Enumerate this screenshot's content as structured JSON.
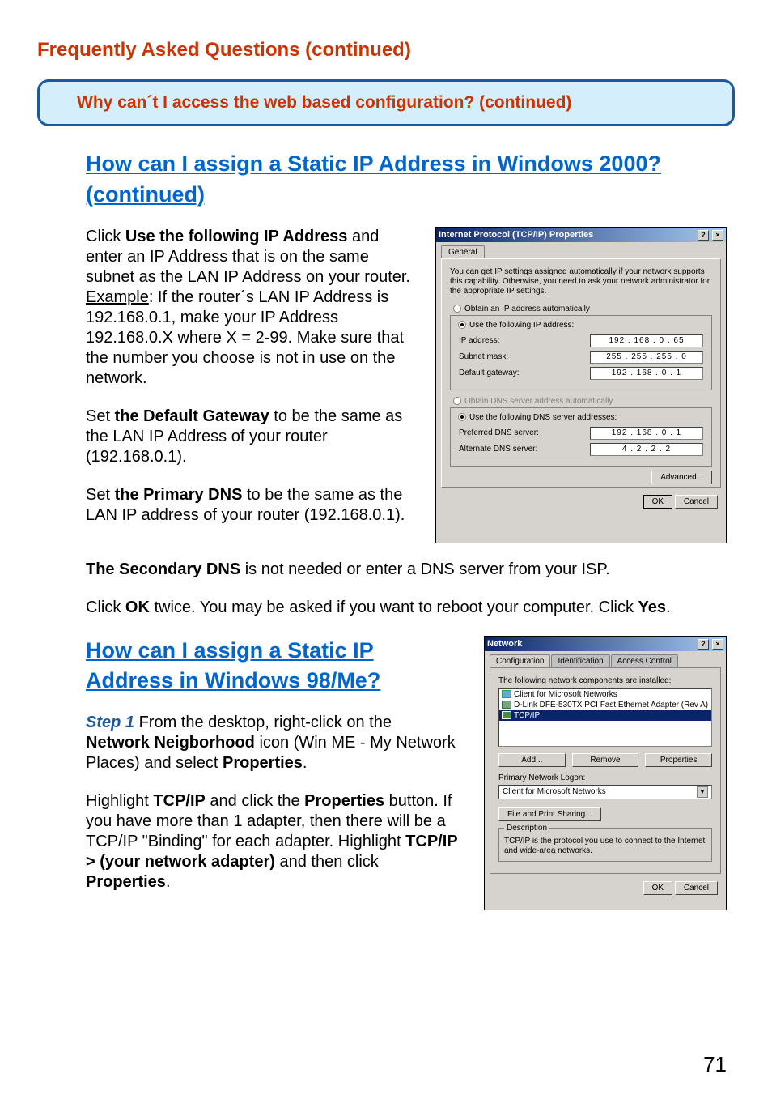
{
  "page_title": "Frequently Asked Questions (continued)",
  "callout": "Why can´t I access the web based configuration? (continued)",
  "heading1": "How can I assign a Static IP Address in Windows 2000? (continued)",
  "p1_a": "Click ",
  "p1_bold1": "Use the following IP Address",
  "p1_b": " and enter an IP Address that is on the same subnet as the LAN IP Address on your router. ",
  "p1_ex": "Example",
  "p1_c": ": If the router´s LAN IP Address is 192.168.0.1, make your IP Address 192.168.0.X where X = 2-99. Make sure that the number you choose is not in use on the network.",
  "p2_a": "Set ",
  "p2_bold": "the Default Gateway",
  "p2_b": " to be the same as the LAN IP Address of your router (192.168.0.1).",
  "p3_a": "Set ",
  "p3_bold": "the Primary DNS",
  "p3_b": " to be the same as the LAN IP address of your router (192.168.0.1).",
  "p4_bold": "The Secondary DNS",
  "p4_b": " is not needed or enter a DNS server from your ISP.",
  "p5_a": "Click ",
  "p5_bold1": "OK",
  "p5_b": " twice. You may be asked if you want to reboot your computer. Click ",
  "p5_bold2": "Yes",
  "p5_c": ".",
  "heading2": "How can I assign a Static IP Address  in Windows 98/Me?",
  "step1_label": "Step 1",
  "step1_a": " From the desktop, right-click on the ",
  "step1_bold": "Network Neigborhood",
  "step1_b": " icon (Win ME - My Network Places) and select ",
  "step1_bold2": "Properties",
  "step1_c": ".",
  "p6_a": "Highlight ",
  "p6_bold1": "TCP/IP",
  "p6_b": " and click the ",
  "p6_bold2": "Properties",
  "p6_c": " button. If you have more than 1 adapter, then there will be a TCP/IP \"Binding\" for each adapter. Highlight ",
  "p6_bold3": "TCP/IP > (your network adapter)",
  "p6_d": " and then click ",
  "p6_bold4": "Properties",
  "p6_e": ".",
  "page_number": "71",
  "win2k": {
    "title": "Internet Protocol (TCP/IP) Properties",
    "tab": "General",
    "intro": "You can get IP settings assigned automatically if your network supports this capability. Otherwise, you need to ask your network administrator for the appropriate IP settings.",
    "r1": "Obtain an IP address automatically",
    "r2": "Use the following IP address:",
    "ip_label": "IP address:",
    "ip_val": "192 . 168 .  0  . 65",
    "mask_label": "Subnet mask:",
    "mask_val": "255 . 255 . 255 .  0",
    "gw_label": "Default gateway:",
    "gw_val": "192 . 168 .  0  .  1",
    "r3": "Obtain DNS server address automatically",
    "r4": "Use the following DNS server addresses:",
    "pdns_label": "Preferred DNS server:",
    "pdns_val": "192 . 168 .  0  .  1",
    "adns_label": "Alternate DNS server:",
    "adns_val": " 4  .  2  .  2  .  2",
    "advanced": "Advanced...",
    "ok": "OK",
    "cancel": "Cancel",
    "help": "?",
    "close": "×"
  },
  "win98": {
    "title": "Network",
    "help": "?",
    "close": "×",
    "tab1": "Configuration",
    "tab2": "Identification",
    "tab3": "Access Control",
    "list_label": "The following network components are installed:",
    "item1": "Client for Microsoft Networks",
    "item2": "D-Link DFE-530TX PCI Fast Ethernet Adapter (Rev A)",
    "item3": "TCP/IP",
    "add": "Add...",
    "remove": "Remove",
    "properties": "Properties",
    "logon_label": "Primary Network Logon:",
    "logon_value": "Client for Microsoft Networks",
    "file_print": "File and Print Sharing...",
    "desc_head": "Description",
    "desc_body": "TCP/IP is the protocol you use to connect to the Internet and wide-area networks.",
    "ok": "OK",
    "cancel": "Cancel"
  }
}
